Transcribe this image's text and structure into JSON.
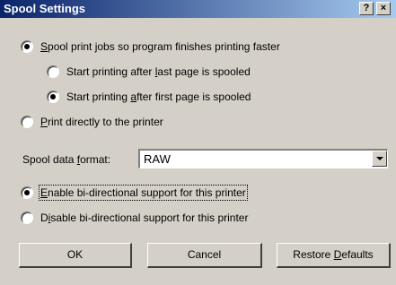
{
  "window": {
    "title": "Spool Settings",
    "help_glyph": "?",
    "close_glyph": "×"
  },
  "spool_options": {
    "spool": {
      "pre": "",
      "key": "S",
      "post": "pool print jobs so program finishes printing faster",
      "selected": true
    },
    "after_last": {
      "pre": "Start printing after ",
      "key": "l",
      "post": "ast page is spooled",
      "selected": false
    },
    "after_first": {
      "pre": "Start printing ",
      "key": "a",
      "post": "fter first page is spooled",
      "selected": true
    },
    "direct": {
      "pre": "",
      "key": "P",
      "post": "rint directly to the printer",
      "selected": false
    }
  },
  "format": {
    "label_pre": "Spool data ",
    "label_key": "f",
    "label_post": "ormat:",
    "value": "RAW"
  },
  "bidi_options": {
    "enable": {
      "pre": "",
      "key": "E",
      "post": "nable bi-directional support for this printer",
      "selected": true
    },
    "disable": {
      "pre": "D",
      "key": "i",
      "post": "sable bi-directional support for this printer",
      "selected": false
    }
  },
  "buttons": {
    "ok": "OK",
    "cancel": "Cancel",
    "restore_pre": "Restore ",
    "restore_key": "D",
    "restore_post": "efaults"
  }
}
